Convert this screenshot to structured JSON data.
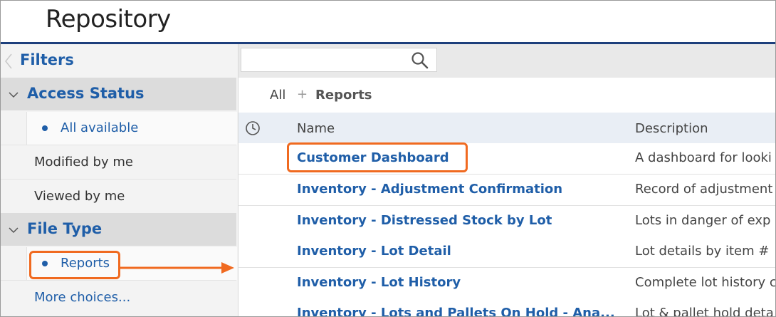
{
  "header": {
    "title": "Repository"
  },
  "filters": {
    "label": "Filters",
    "sections": [
      {
        "title": "Access Status",
        "options": [
          "All available",
          "Modified by me",
          "Viewed by me"
        ],
        "selected": "All available"
      },
      {
        "title": "File Type",
        "options": [
          "Reports",
          "More choices..."
        ],
        "selected": "Reports"
      }
    ]
  },
  "search": {
    "placeholder": ""
  },
  "breadcrumb": {
    "all": "All",
    "separator": "+",
    "current": "Reports"
  },
  "table": {
    "columns": [
      "Name",
      "Description"
    ],
    "rows": [
      {
        "name": "Customer Dashboard",
        "description": "A dashboard for looki"
      },
      {
        "name": "Inventory - Adjustment Confirmation",
        "description": "Record of adjustment"
      },
      {
        "name": "Inventory - Distressed Stock by Lot",
        "description": "Lots in danger of exp"
      },
      {
        "name": "Inventory - Lot Detail",
        "description": "Lot details by item #"
      },
      {
        "name": "Inventory - Lot History",
        "description": "Complete lot history c"
      },
      {
        "name": "Inventory - Lots and Pallets On Hold - Ana...",
        "description": "Lot & pallet hold deta"
      }
    ]
  },
  "colors": {
    "accent": "#1f5ea8",
    "header_rule": "#1d3f7c",
    "callout": "#f06a20"
  },
  "icons": {
    "filters_collapse": "chevron-left-icon",
    "section_toggle": "chevron-down-icon",
    "search": "search-icon",
    "sort": "clock-icon"
  }
}
